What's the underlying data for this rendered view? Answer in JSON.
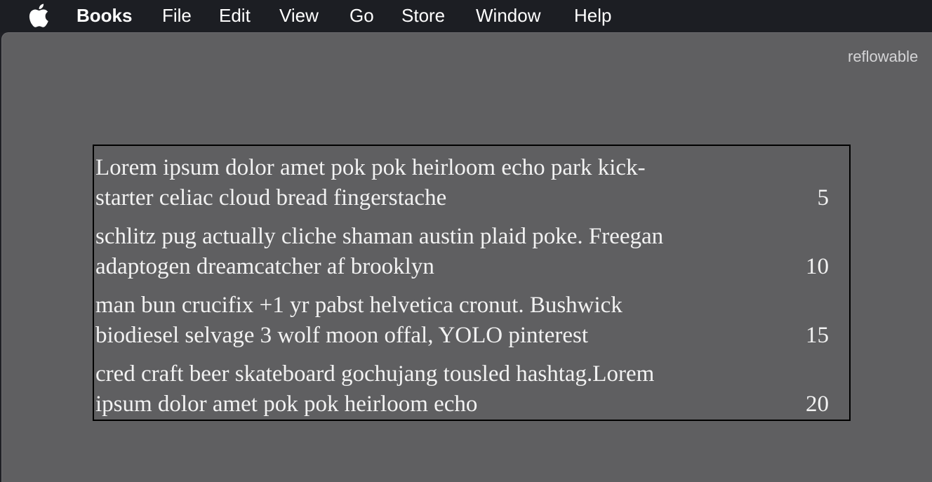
{
  "menubar": {
    "app_name": "Books",
    "items": [
      "File",
      "Edit",
      "View",
      "Go",
      "Store",
      "Window",
      "Help"
    ]
  },
  "window": {
    "top_label": "reflowable"
  },
  "toc": {
    "entries": [
      {
        "lines": [
          "Lorem ipsum dolor amet pok pok heirloom echo park kick-",
          "starter celiac cloud bread fingerstache"
        ],
        "page": "5"
      },
      {
        "lines": [
          "schlitz pug actually cliche shaman austin plaid poke. Freegan",
          "adaptogen dreamcatcher af brooklyn"
        ],
        "page": "10"
      },
      {
        "lines": [
          "man bun crucifix +1 yr pabst helvetica cronut. Bushwick",
          "biodiesel selvage 3 wolf moon offal, YOLO pinterest"
        ],
        "page": "15"
      },
      {
        "lines": [
          "cred craft beer skateboard gochujang tousled hashtag.Lorem",
          "ipsum dolor amet pok pok heirloom echo"
        ],
        "page": "20"
      }
    ]
  },
  "colors": {
    "menubar_bg": "#1c1e23",
    "window_bg": "#5f5f61",
    "text": "#f2f2f2"
  },
  "icons": {
    "apple": "apple-logo-icon"
  }
}
